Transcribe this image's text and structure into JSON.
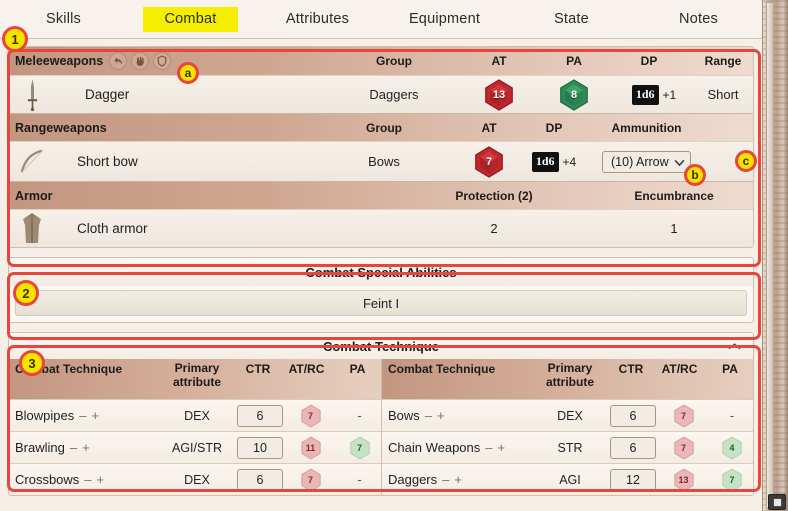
{
  "tabs": [
    {
      "label": "Skills",
      "active": false
    },
    {
      "label": "Combat",
      "active": true
    },
    {
      "label": "Attributes",
      "active": false
    },
    {
      "label": "Equipment",
      "active": false
    },
    {
      "label": "State",
      "active": false
    },
    {
      "label": "Notes",
      "active": false
    }
  ],
  "melee": {
    "title": "Meleeweapons",
    "icons": [
      "undo-icon",
      "gauntlet-icon",
      "shield-icon"
    ],
    "columns": {
      "group": "Group",
      "at": "AT",
      "pa": "PA",
      "dp": "DP",
      "range": "Range"
    },
    "rows": [
      {
        "icon": "dagger-icon",
        "name": "Dagger",
        "group": "Daggers",
        "at": "13",
        "pa": "8",
        "dp_dice": "1d6",
        "dp_mod": "+1",
        "range": "Short"
      }
    ]
  },
  "ranged": {
    "title": "Rangeweapons",
    "columns": {
      "group": "Group",
      "at": "AT",
      "dp": "DP",
      "ammunition": "Ammunition"
    },
    "rows": [
      {
        "icon": "bow-icon",
        "name": "Short bow",
        "group": "Bows",
        "at": "7",
        "dp_dice": "1d6",
        "dp_mod": "+4",
        "ammo_selected": "(10) Arrow",
        "ammo_options": [
          "(10) Arrow"
        ]
      }
    ]
  },
  "armor": {
    "title": "Armor",
    "columns": {
      "protection": "Protection (2)",
      "encumbrance": "Encumbrance"
    },
    "rows": [
      {
        "icon": "armor-icon",
        "name": "Cloth armor",
        "protection": "2",
        "encumbrance": "1"
      }
    ]
  },
  "special_abilities": {
    "title": "Combat Special Abilities",
    "items": [
      "Feint I"
    ]
  },
  "combat_technique": {
    "title": "Combat Technique",
    "collapse_icon": "chevron-up-icon",
    "columns": {
      "name": "Combat Technique",
      "primary": "Primary attribute",
      "primary_l1": "Primary",
      "primary_l2": "attribute",
      "ctr": "CTR",
      "atrc": "AT/RC",
      "pa": "PA"
    },
    "left_rows": [
      {
        "name": "Blowpipes",
        "primary": "DEX",
        "ctr": "6",
        "atrc": "7",
        "pa": "-"
      },
      {
        "name": "Brawling",
        "primary": "AGI/STR",
        "ctr": "10",
        "atrc": "11",
        "pa": "7"
      },
      {
        "name": "Crossbows",
        "primary": "DEX",
        "ctr": "6",
        "atrc": "7",
        "pa": "-"
      }
    ],
    "right_rows": [
      {
        "name": "Bows",
        "primary": "DEX",
        "ctr": "6",
        "atrc": "7",
        "pa": "-"
      },
      {
        "name": "Chain Weapons",
        "primary": "STR",
        "ctr": "6",
        "atrc": "7",
        "pa": "4"
      },
      {
        "name": "Daggers",
        "primary": "AGI",
        "ctr": "12",
        "atrc": "13",
        "pa": "7"
      }
    ],
    "decrement_label": "–",
    "increment_label": "+"
  },
  "annotations": {
    "boxes": [
      {
        "id": "1",
        "label": "1"
      },
      {
        "id": "2",
        "label": "2"
      },
      {
        "id": "3",
        "label": "3"
      }
    ],
    "letters": [
      {
        "id": "a",
        "label": "a"
      },
      {
        "id": "b",
        "label": "b"
      },
      {
        "id": "c",
        "label": "c"
      }
    ],
    "color_box": "#e8453c",
    "color_badge": "#f5e400"
  },
  "colors": {
    "active_tab_bg": "#f5ee00",
    "at_dice": "#c1272d",
    "pa_dice": "#2e8b57",
    "header_gradient_start": "#c39680"
  }
}
